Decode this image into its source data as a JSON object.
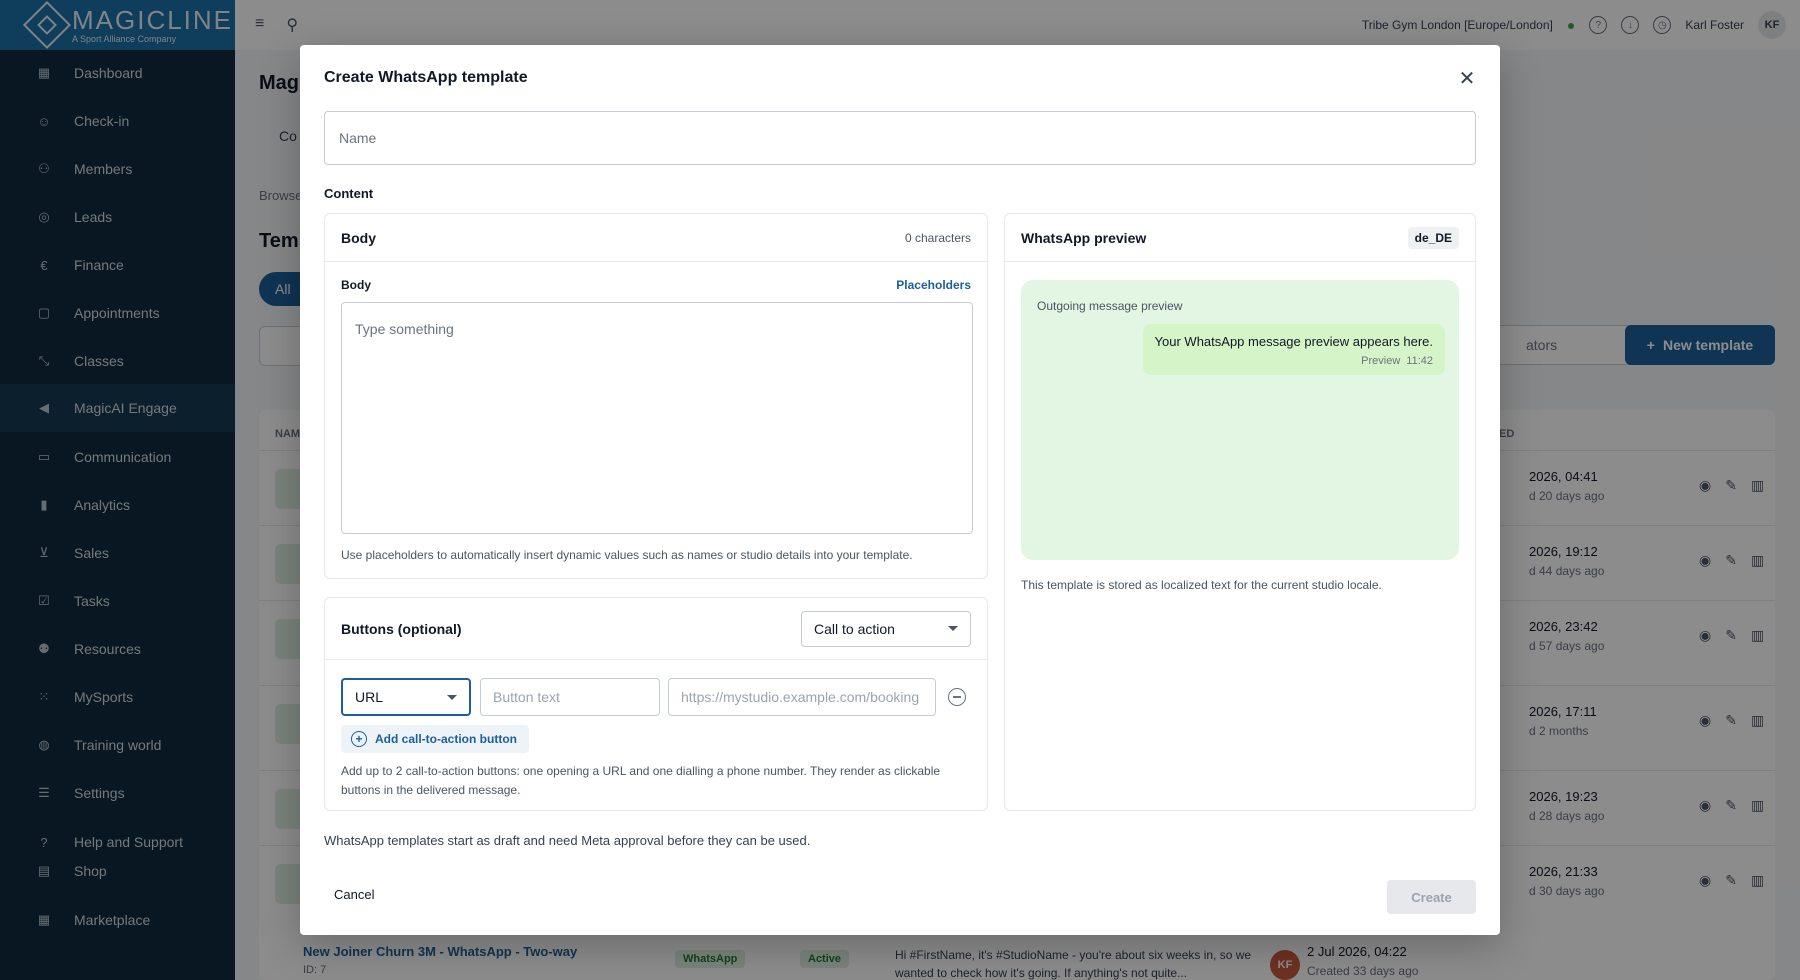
{
  "brand": {
    "name": "MAGICLINE",
    "tagline": "A Sport Alliance Company"
  },
  "sidebar": {
    "items": [
      {
        "label": "Dashboard",
        "icon": "grid-icon"
      },
      {
        "label": "Check-in",
        "icon": "person-check-icon"
      },
      {
        "label": "Members",
        "icon": "users-icon"
      },
      {
        "label": "Leads",
        "icon": "target-icon"
      },
      {
        "label": "Finance",
        "icon": "euro-icon"
      },
      {
        "label": "Appointments",
        "icon": "calendar-icon"
      },
      {
        "label": "Classes",
        "icon": "dumbbell-icon"
      },
      {
        "label": "MagicAI Engage",
        "icon": "megaphone-icon",
        "active": true
      },
      {
        "label": "Communication",
        "icon": "chat-icon"
      },
      {
        "label": "Analytics",
        "icon": "bar-chart-icon"
      },
      {
        "label": "Sales",
        "icon": "cart-icon"
      },
      {
        "label": "Tasks",
        "icon": "checkbox-icon"
      },
      {
        "label": "Resources",
        "icon": "people-group-icon"
      },
      {
        "label": "MySports",
        "icon": "apps-icon"
      },
      {
        "label": "Training world",
        "icon": "globe-icon"
      },
      {
        "label": "Settings",
        "icon": "sliders-icon"
      },
      {
        "label": "Help and Support",
        "icon": "help-icon"
      },
      {
        "label": "Shop",
        "icon": "store-icon"
      },
      {
        "label": "Marketplace",
        "icon": "marketplace-icon"
      }
    ]
  },
  "topbar": {
    "studio": "Tribe Gym London [Europe/London]",
    "user": "Karl Foster",
    "initials": "KF"
  },
  "background": {
    "title": "Magi",
    "tab": "Co",
    "browse": "Browse",
    "heading": "Temp",
    "filter_all": "All",
    "select_value": "ators",
    "new_template": "New template",
    "col_name": "NAM",
    "col_created": "ED",
    "rows": [
      {
        "date": "2026, 04:41",
        "ago": "d 20 days ago"
      },
      {
        "date": "2026, 19:12",
        "ago": "d 44 days ago"
      },
      {
        "date": "2026, 23:42",
        "ago": "d 57 days ago"
      },
      {
        "date": "2026, 17:11",
        "ago": "d 2 months"
      },
      {
        "date": "2026, 19:23",
        "ago": "d 28 days ago"
      },
      {
        "date": "2026, 21:33",
        "ago": "d 30 days ago"
      }
    ],
    "last_row": {
      "name": "New Joiner Churn 3M - WhatsApp - Two-way",
      "id": "ID: 7",
      "channel": "WhatsApp",
      "status": "Active",
      "preview": "Hi #FirstName, it's #StudioName - you're about six weeks in, so we wanted to check how it's going. If anything's not quite...",
      "author": "KF",
      "date": "2 Jul 2026, 04:22",
      "ago": "Created 33 days ago"
    }
  },
  "modal": {
    "title": "Create WhatsApp template",
    "name_placeholder": "Name",
    "content_label": "Content",
    "body_card": {
      "title": "Body",
      "char_count": "0 characters",
      "body_label": "Body",
      "placeholders_link": "Placeholders",
      "textarea_placeholder": "Type something",
      "hint": "Use placeholders to automatically insert dynamic values such as names or studio details into your template."
    },
    "buttons_card": {
      "title": "Buttons (optional)",
      "type_select": "Call to action",
      "row": {
        "type": "URL",
        "text_placeholder": "Button text",
        "url_placeholder": "https://mystudio.example.com/booking"
      },
      "add_button": "Add call-to-action button",
      "hint": "Add up to 2 call-to-action buttons: one opening a URL and one dialling a phone number. They render as clickable buttons in the delivered message."
    },
    "preview_card": {
      "title": "WhatsApp preview",
      "locale": "de_DE",
      "area_label": "Outgoing message preview",
      "bubble_text": "Your WhatsApp message preview appears here.",
      "bubble_tag": "Preview",
      "bubble_time": "11:42",
      "locale_note": "This template is stored as localized text for the current studio locale."
    },
    "draft_note": "WhatsApp templates start as draft and need Meta approval before they can be used.",
    "cancel_label": "Cancel",
    "create_label": "Create"
  }
}
